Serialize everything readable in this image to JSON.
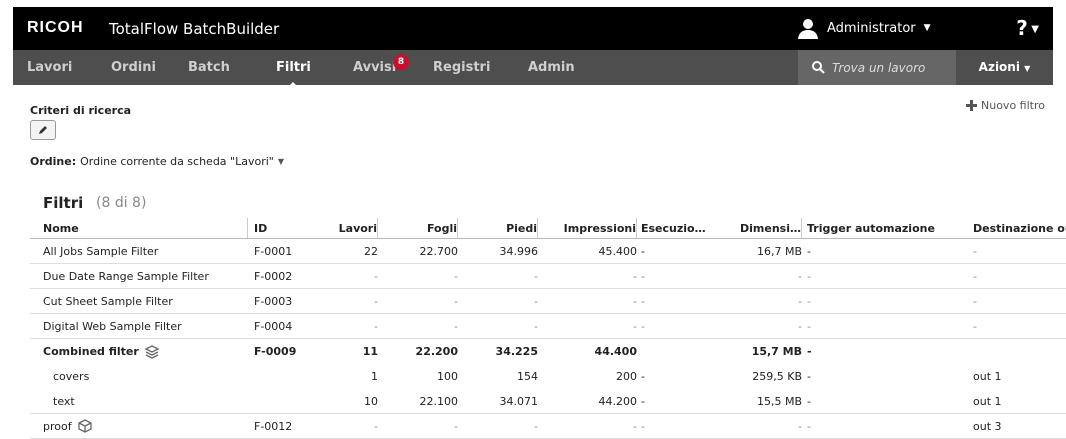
{
  "header": {
    "brand": "RICOH",
    "product": "TotalFlow BatchBuilder",
    "user": "Administrator",
    "help": "?"
  },
  "nav": {
    "items": [
      {
        "label": "Lavori"
      },
      {
        "label": "Ordini"
      },
      {
        "label": "Batch"
      },
      {
        "label": "Filtri",
        "active": true
      },
      {
        "label": "Avvisi",
        "badge": "8"
      },
      {
        "label": "Registri"
      },
      {
        "label": "Admin"
      }
    ],
    "search_placeholder": "Trova un lavoro",
    "actions_label": "Azioni"
  },
  "criteria": {
    "label": "Criteri di ricerca",
    "new_filter": "Nuovo filtro",
    "order_label": "Ordine:",
    "order_value": "Ordine corrente da scheda \"Lavori\""
  },
  "filters": {
    "title": "Filtri",
    "count": "(8 di 8)",
    "columns": {
      "nome": "Nome",
      "id": "ID",
      "lavori": "Lavori",
      "fogli": "Fogli",
      "piedi": "Piedi",
      "impressioni": "Impressioni",
      "esecuzione": "Esecuzio…",
      "dimensione": "Dimensi…",
      "trigger": "Trigger automazione",
      "destinazione": "Destinazione output"
    },
    "rows": [
      {
        "nome": "All Jobs Sample Filter",
        "id": "F-0001",
        "lavori": "22",
        "fogli": "22.700",
        "piedi": "34.996",
        "impressioni": "45.400",
        "esecuzione": "-",
        "dimensione": "16,7 MB",
        "trigger": "-",
        "destinazione": "-"
      },
      {
        "nome": "Due Date Range Sample Filter",
        "id": "F-0002",
        "lavori": "-",
        "fogli": "-",
        "piedi": "-",
        "impressioni": "-",
        "esecuzione": "-",
        "dimensione": "-",
        "trigger": "-",
        "destinazione": "-"
      },
      {
        "nome": "Cut Sheet Sample Filter",
        "id": "F-0003",
        "lavori": "-",
        "fogli": "-",
        "piedi": "-",
        "impressioni": "-",
        "esecuzione": "-",
        "dimensione": "-",
        "trigger": "-",
        "destinazione": "-"
      },
      {
        "nome": "Digital Web Sample Filter",
        "id": "F-0004",
        "lavori": "-",
        "fogli": "-",
        "piedi": "-",
        "impressioni": "-",
        "esecuzione": "-",
        "dimensione": "-",
        "trigger": "-",
        "destinazione": "-"
      },
      {
        "nome": "Combined filter",
        "id": "F-0009",
        "lavori": "11",
        "fogli": "22.200",
        "piedi": "34.225",
        "impressioni": "44.400",
        "esecuzione": "",
        "dimensione": "15,7 MB",
        "trigger": "-",
        "destinazione": ""
      },
      {
        "nome": "covers",
        "id": "",
        "lavori": "1",
        "fogli": "100",
        "piedi": "154",
        "impressioni": "200",
        "esecuzione": "-",
        "dimensione": "259,5 KB",
        "trigger": "-",
        "destinazione": "out 1"
      },
      {
        "nome": "text",
        "id": "",
        "lavori": "10",
        "fogli": "22.100",
        "piedi": "34.071",
        "impressioni": "44.200",
        "esecuzione": "-",
        "dimensione": "15,5 MB",
        "trigger": "-",
        "destinazione": "out 1"
      },
      {
        "nome": "proof",
        "id": "F-0012",
        "lavori": "-",
        "fogli": "-",
        "piedi": "-",
        "impressioni": "-",
        "esecuzione": "-",
        "dimensione": "-",
        "trigger": "-",
        "destinazione": "out 3"
      }
    ]
  },
  "colors": {
    "topbar": "#000000",
    "navbar": "#4e4e4e",
    "badge": "#c8102e"
  },
  "icons": [
    "user-icon",
    "search-icon",
    "pencil-icon",
    "plus-icon",
    "layers-icon",
    "package-icon",
    "caret-down-icon"
  ]
}
